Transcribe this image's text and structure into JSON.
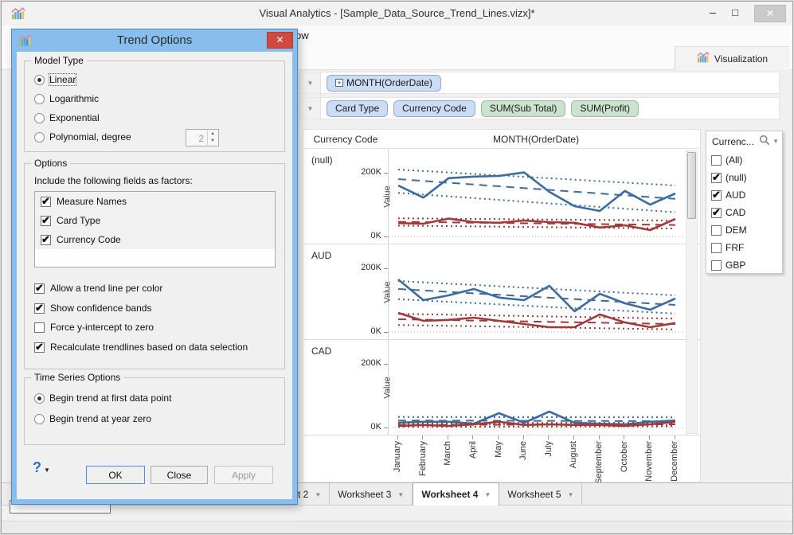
{
  "icons": {
    "caret_down": "▼",
    "minimize": "–",
    "maximize": "□",
    "close": "✕",
    "expand_plus": "+"
  },
  "window": {
    "title": "Visual Analytics - [Sample_Data_Source_Trend_Lines.vizx]*"
  },
  "menubar": {
    "visible_text": "ow"
  },
  "toolbar": {
    "visible_text": "]",
    "visualization_tab": "Visualization"
  },
  "shelves": {
    "row1_pills": [
      {
        "label": "MONTH(OrderDate)",
        "type": "dimension",
        "expandable": true
      }
    ],
    "row2_pills": [
      {
        "label": "Card Type",
        "type": "dimension"
      },
      {
        "label": "Currency Code",
        "type": "dimension"
      },
      {
        "label": "SUM(Sub Total)",
        "type": "measure"
      },
      {
        "label": "SUM(Profit)",
        "type": "measure"
      }
    ]
  },
  "chart_data": {
    "type": "line",
    "row_header": "Currency Code",
    "col_header": "MONTH(OrderDate)",
    "ylabel": "Value",
    "yticks": [
      "200K",
      "0K"
    ],
    "ylim_k": [
      0,
      275
    ],
    "grid": "zero-line-dotted",
    "trend_model": "Linear with confidence bands",
    "x": [
      "January",
      "February",
      "March",
      "April",
      "May",
      "June",
      "July",
      "August",
      "September",
      "October",
      "November",
      "December"
    ],
    "panels": [
      {
        "name": "(null)",
        "series": [
          {
            "name": "SUM(Sub Total)",
            "color": "#3C6C9D",
            "values_k": [
              160,
              122,
              183,
              188,
              190,
              201,
              140,
              95,
              80,
              143,
              100,
              135
            ],
            "trend_k": [
              180,
              118
            ],
            "band_upper_k": [
              210,
              160
            ],
            "band_lower_k": [
              137,
              76
            ]
          },
          {
            "name": "SUM(Profit)",
            "color": "#9E3B3A",
            "values_k": [
              42,
              40,
              56,
              45,
              43,
              50,
              45,
              43,
              28,
              35,
              20,
              55
            ],
            "trend_k": [
              46,
              36
            ],
            "band_upper_k": [
              57,
              50
            ],
            "band_lower_k": [
              34,
              25
            ]
          }
        ]
      },
      {
        "name": "AUD",
        "series": [
          {
            "name": "SUM(Sub Total)",
            "color": "#3C6C9D",
            "values_k": [
              165,
              100,
              115,
              135,
              108,
              100,
              145,
              65,
              120,
              90,
              70,
              105
            ],
            "trend_k": [
              135,
              85
            ],
            "band_upper_k": [
              160,
              115
            ],
            "band_lower_k": [
              103,
              58
            ]
          },
          {
            "name": "SUM(Profit)",
            "color": "#9E3B3A",
            "values_k": [
              60,
              35,
              38,
              45,
              35,
              25,
              15,
              15,
              55,
              30,
              15,
              28
            ],
            "trend_k": [
              40,
              25
            ],
            "band_upper_k": [
              57,
              42
            ],
            "band_lower_k": [
              22,
              8
            ]
          }
        ]
      },
      {
        "name": "CAD",
        "series": [
          {
            "name": "SUM(Sub Total)",
            "color": "#3C6C9D",
            "values_k": [
              15,
              18,
              18,
              12,
              45,
              15,
              50,
              15,
              12,
              10,
              18,
              22
            ],
            "trend_k": [
              22,
              20
            ],
            "band_upper_k": [
              33,
              32
            ],
            "band_lower_k": [
              10,
              8
            ]
          },
          {
            "name": "SUM(Profit)",
            "color": "#9E3B3A",
            "values_k": [
              5,
              8,
              5,
              10,
              18,
              8,
              10,
              8,
              8,
              5,
              10,
              18
            ],
            "trend_k": [
              8,
              10
            ],
            "band_upper_k": [
              14,
              15
            ],
            "band_lower_k": [
              2,
              4
            ]
          }
        ]
      }
    ]
  },
  "filter_panel": {
    "title": "Currenc...",
    "items": [
      {
        "label": "(All)",
        "checked": false
      },
      {
        "label": "(null)",
        "checked": true
      },
      {
        "label": "AUD",
        "checked": true
      },
      {
        "label": "CAD",
        "checked": true
      },
      {
        "label": "DEM",
        "checked": false
      },
      {
        "label": "FRF",
        "checked": false
      },
      {
        "label": "GBP",
        "checked": false
      }
    ]
  },
  "worksheet_tabs": [
    {
      "label": "t 2",
      "active": false
    },
    {
      "label": "Worksheet 3",
      "active": false
    },
    {
      "label": "Worksheet 4",
      "active": true
    },
    {
      "label": "Worksheet 5",
      "active": false
    }
  ],
  "dialog": {
    "title": "Trend Options",
    "model_type": {
      "legend": "Model Type",
      "options": [
        {
          "label": "Linear",
          "selected": true
        },
        {
          "label": "Logarithmic",
          "selected": false
        },
        {
          "label": "Exponential",
          "selected": false
        },
        {
          "label": "Polynomial, degree",
          "selected": false
        }
      ],
      "degree_value": "2"
    },
    "options": {
      "legend": "Options",
      "factors_caption": "Include the following fields as factors:",
      "factors": [
        {
          "label": "Measure Names",
          "checked": true
        },
        {
          "label": "Card Type",
          "checked": true
        },
        {
          "label": "Currency Code",
          "checked": true
        }
      ],
      "checkboxes": [
        {
          "label": "Allow a trend line per color",
          "checked": true
        },
        {
          "label": "Show confidence bands",
          "checked": true
        },
        {
          "label": "Force y-intercept to zero",
          "checked": false
        },
        {
          "label": "Recalculate trendlines based on data selection",
          "checked": true
        }
      ]
    },
    "time_series": {
      "legend": "Time Series Options",
      "options": [
        {
          "label": "Begin trend at first data point",
          "selected": true
        },
        {
          "label": "Begin trend at year zero",
          "selected": false
        }
      ]
    },
    "footer": {
      "help": "?",
      "ok": "OK",
      "close": "Close",
      "apply": "Apply"
    }
  },
  "colors": {
    "dialog_frame": "#87BEEC",
    "dialog_close": "#D0493F",
    "pill_dimension": "#CBDCF4",
    "pill_measure": "#CBE3CD",
    "series_subtotal": "#3C6C9D",
    "series_profit": "#9E3B3A"
  }
}
